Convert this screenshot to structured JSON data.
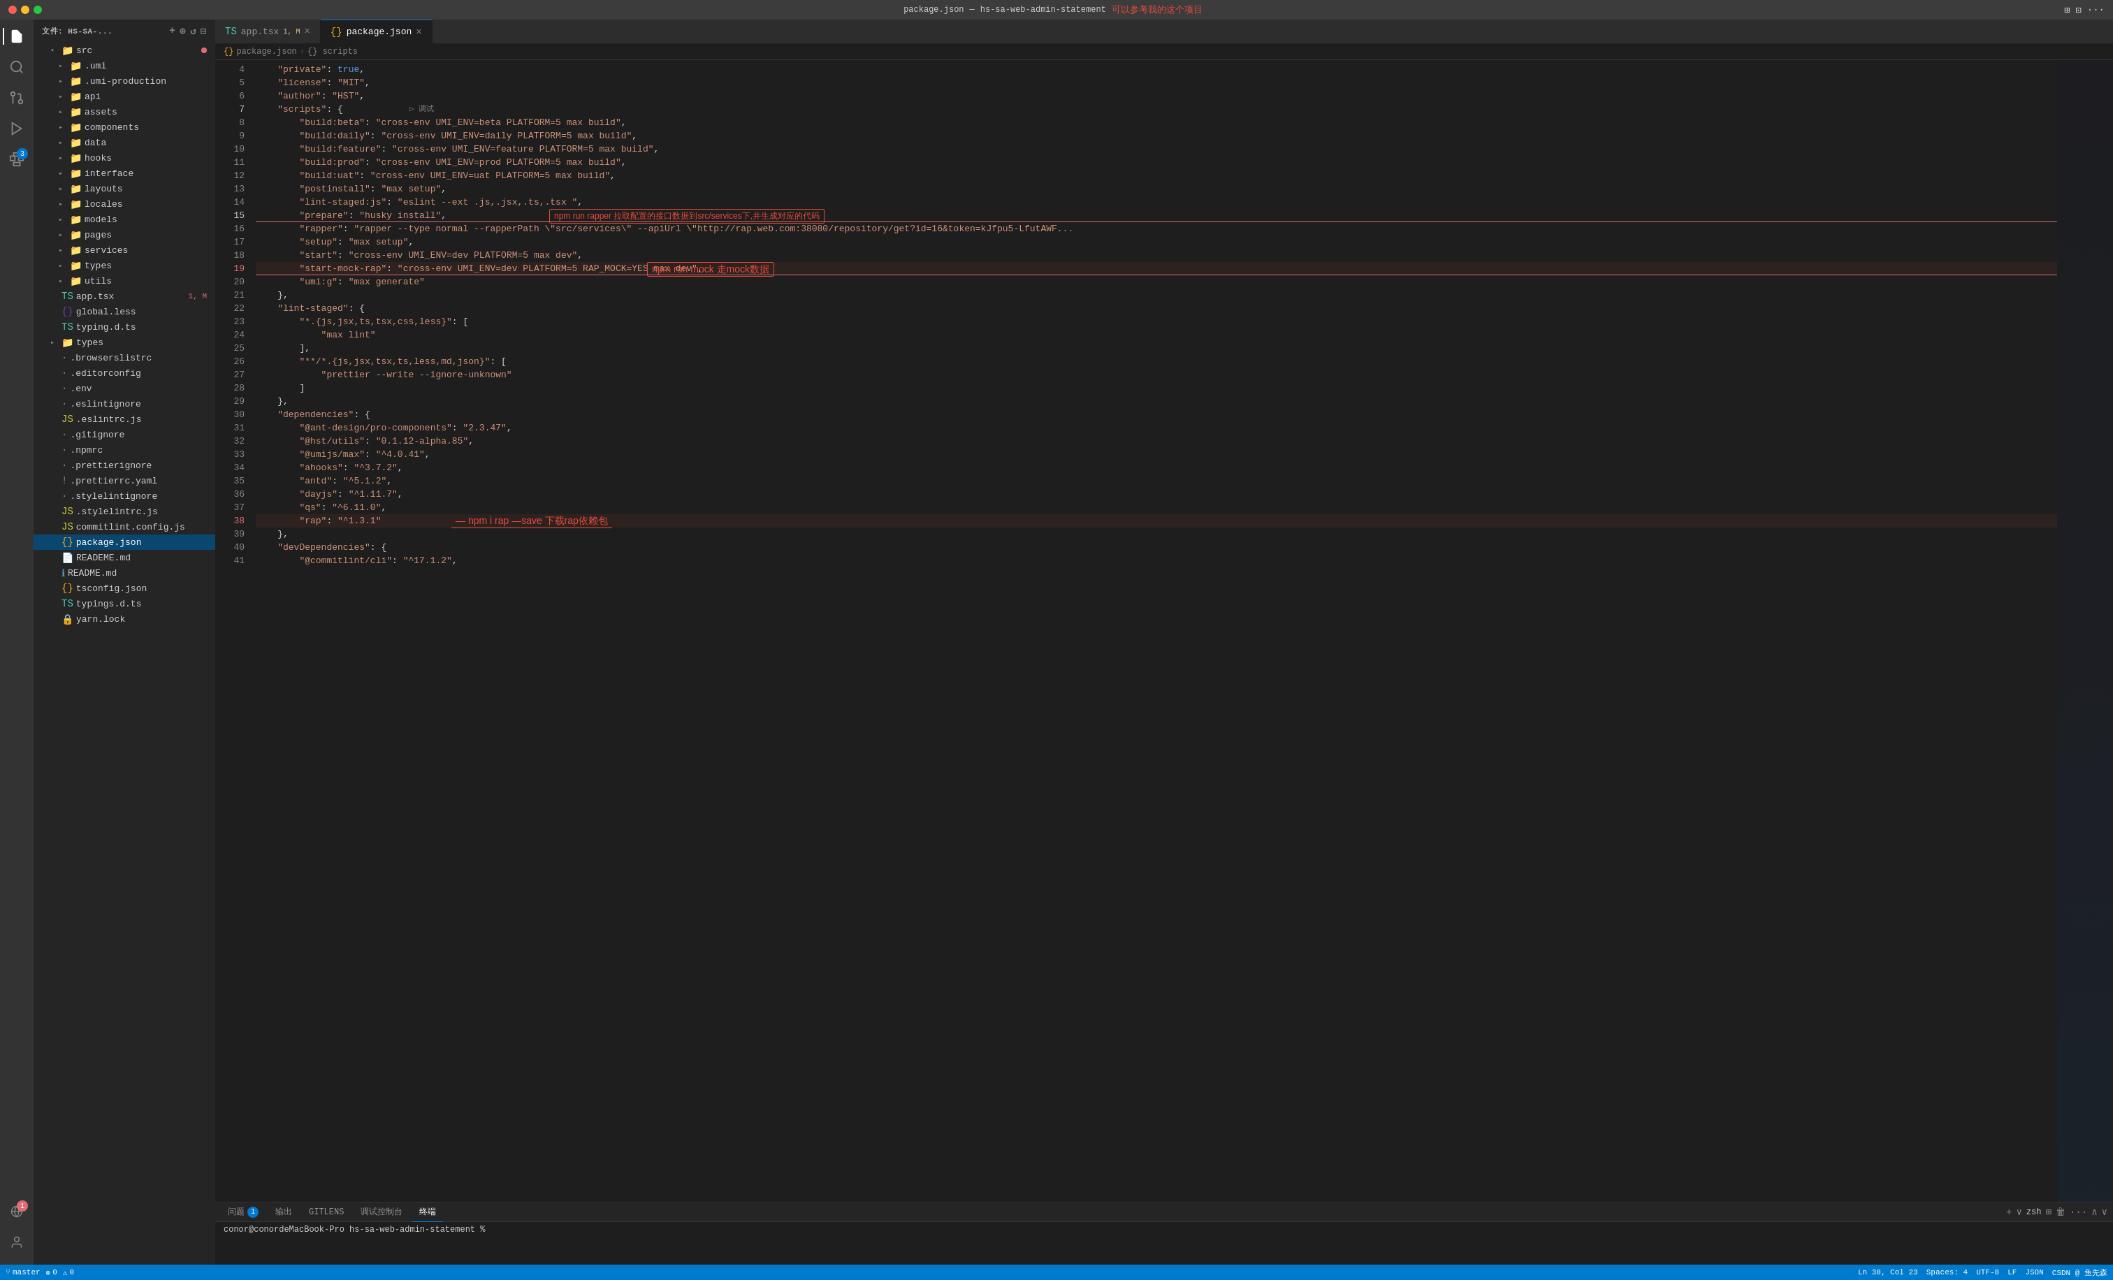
{
  "titlebar": {
    "filename": "package.json",
    "project": "hs-sa-web-admin-statement",
    "annotation": "可以参考我的这个项目"
  },
  "activitybar": {
    "icons": [
      {
        "name": "files-icon",
        "symbol": "⬛",
        "active": true
      },
      {
        "name": "search-icon",
        "symbol": "🔍",
        "active": false
      },
      {
        "name": "source-control-icon",
        "symbol": "⑂",
        "active": false
      },
      {
        "name": "run-icon",
        "symbol": "▷",
        "active": false
      },
      {
        "name": "extensions-icon",
        "symbol": "⊞",
        "active": false,
        "badge": "3"
      }
    ],
    "bottom_icons": [
      {
        "name": "remote-icon",
        "symbol": "⚡",
        "badge": "1"
      },
      {
        "name": "account-icon",
        "symbol": "👤"
      }
    ]
  },
  "sidebar": {
    "header": "文件: HS-SA-...",
    "tree": [
      {
        "level": 0,
        "label": "src",
        "type": "folder",
        "expanded": true,
        "dot": true
      },
      {
        "level": 1,
        "label": ".umi",
        "type": "folder",
        "expanded": false
      },
      {
        "level": 1,
        "label": ".umi-production",
        "type": "folder",
        "expanded": false
      },
      {
        "level": 1,
        "label": "api",
        "type": "folder",
        "expanded": false
      },
      {
        "level": 1,
        "label": "assets",
        "type": "folder",
        "expanded": false
      },
      {
        "level": 1,
        "label": "components",
        "type": "folder",
        "expanded": false
      },
      {
        "level": 1,
        "label": "data",
        "type": "folder",
        "expanded": false
      },
      {
        "level": 1,
        "label": "hooks",
        "type": "folder",
        "expanded": false
      },
      {
        "level": 1,
        "label": "interface",
        "type": "folder",
        "expanded": false
      },
      {
        "level": 1,
        "label": "layouts",
        "type": "folder",
        "expanded": false
      },
      {
        "level": 1,
        "label": "locales",
        "type": "folder",
        "expanded": false
      },
      {
        "level": 1,
        "label": "models",
        "type": "folder",
        "expanded": false
      },
      {
        "level": 1,
        "label": "pages",
        "type": "folder",
        "expanded": false
      },
      {
        "level": 1,
        "label": "services",
        "type": "folder",
        "expanded": false
      },
      {
        "level": 1,
        "label": "types",
        "type": "folder",
        "expanded": false
      },
      {
        "level": 1,
        "label": "utils",
        "type": "folder",
        "expanded": false
      },
      {
        "level": 0,
        "label": "app.tsx",
        "type": "tsx",
        "badge": "1, M"
      },
      {
        "level": 0,
        "label": "global.less",
        "type": "less"
      },
      {
        "level": 0,
        "label": "typing.d.ts",
        "type": "ts"
      },
      {
        "level": 0,
        "label": "types",
        "type": "folder"
      },
      {
        "level": 0,
        "label": ".browserslistrc",
        "type": "file"
      },
      {
        "level": 0,
        "label": ".editorconfig",
        "type": "file"
      },
      {
        "level": 0,
        "label": ".env",
        "type": "file"
      },
      {
        "level": 0,
        "label": ".eslintignore",
        "type": "file"
      },
      {
        "level": 0,
        "label": ".eslintrc.js",
        "type": "js"
      },
      {
        "level": 0,
        "label": ".gitignore",
        "type": "file"
      },
      {
        "level": 0,
        "label": ".npmrc",
        "type": "file"
      },
      {
        "level": 0,
        "label": ".prettierignore",
        "type": "file"
      },
      {
        "level": 0,
        "label": ".prettierrc.yaml",
        "type": "file"
      },
      {
        "level": 0,
        "label": ".stylelintignore",
        "type": "file"
      },
      {
        "level": 0,
        "label": ".stylelintrc.js",
        "type": "js"
      },
      {
        "level": 0,
        "label": "commitlint.config.js",
        "type": "js"
      },
      {
        "level": 0,
        "label": "package.json",
        "type": "json",
        "selected": true
      },
      {
        "level": 0,
        "label": "READEME.md",
        "type": "md"
      },
      {
        "level": 0,
        "label": "README.md",
        "type": "md"
      },
      {
        "level": 0,
        "label": "tsconfig.json",
        "type": "json"
      },
      {
        "level": 0,
        "label": "typings.d.ts",
        "type": "ts"
      },
      {
        "level": 0,
        "label": "yarn.lock",
        "type": "file"
      }
    ]
  },
  "tabs": [
    {
      "label": "app.tsx",
      "type": "tsx",
      "active": false,
      "modified": "1, M"
    },
    {
      "label": "package.json",
      "type": "json",
      "active": true,
      "modified": ""
    }
  ],
  "breadcrumb": [
    "package.json",
    "scripts"
  ],
  "lines": [
    {
      "num": 4,
      "content": "    \"private\": true,",
      "type": "normal"
    },
    {
      "num": 5,
      "content": "    \"license\": \"MIT\",",
      "type": "normal"
    },
    {
      "num": 6,
      "content": "    \"author\": \"HST\",",
      "type": "normal"
    },
    {
      "num": 7,
      "content": "    \"scripts\": {",
      "type": "normal"
    },
    {
      "num": 8,
      "content": "        \"build:beta\": \"cross-env UMI_ENV=beta PLATFORM=5 max build\",",
      "type": "normal"
    },
    {
      "num": 9,
      "content": "        \"build:daily\": \"cross-env UMI_ENV=daily PLATFORM=5 max build\",",
      "type": "normal"
    },
    {
      "num": 10,
      "content": "        \"build:feature\": \"cross-env UMI_ENV=feature PLATFORM=5 max build\",",
      "type": "normal"
    },
    {
      "num": 11,
      "content": "        \"build:prod\": \"cross-env UMI_ENV=prod PLATFORM=5 max build\",",
      "type": "normal"
    },
    {
      "num": 12,
      "content": "        \"build:uat\": \"cross-env UMI_ENV=uat PLATFORM=5 max build\",",
      "type": "normal"
    },
    {
      "num": 13,
      "content": "        \"postinstall\": \"max setup\",",
      "type": "normal"
    },
    {
      "num": 14,
      "content": "        \"lint-staged:js\": \"eslint --ext .js,.jsx,.ts,.tsx \",",
      "type": "normal"
    },
    {
      "num": 15,
      "content": "        \"prepare\": \"husky install\",",
      "type": "highlighted"
    },
    {
      "num": 16,
      "content": "        \"rapper\": \"rapper --type normal --rapperPath \\\"src/services\\\" --apiUrl \\\"http://rap.web.com:38080/repository/get?id=16&token=kJfpu5-LfutAWF...",
      "type": "normal"
    },
    {
      "num": 17,
      "content": "        \"setup\": \"max setup\",",
      "type": "normal"
    },
    {
      "num": 18,
      "content": "        \"start\": \"cross-env UMI_ENV=dev PLATFORM=5 max dev\",",
      "type": "normal"
    },
    {
      "num": 19,
      "content": "        \"start-mock-rap\": \"cross-env UMI_ENV=dev PLATFORM=5 RAP_MOCK=YES max dev\",",
      "type": "highlighted"
    },
    {
      "num": 20,
      "content": "        \"umi:g\": \"max generate\"",
      "type": "normal"
    },
    {
      "num": 21,
      "content": "    },",
      "type": "normal"
    },
    {
      "num": 22,
      "content": "    \"lint-staged\": {",
      "type": "normal"
    },
    {
      "num": 23,
      "content": "        \"*.{js,jsx,ts,tsx,css,less}\": [",
      "type": "normal"
    },
    {
      "num": 24,
      "content": "            \"max lint\"",
      "type": "normal"
    },
    {
      "num": 25,
      "content": "        ],",
      "type": "normal"
    },
    {
      "num": 26,
      "content": "        \"**/*.{js,jsx,tsx,ts,less,md,json}\": [",
      "type": "normal"
    },
    {
      "num": 27,
      "content": "            \"prettier --write --ignore-unknown\"",
      "type": "normal"
    },
    {
      "num": 28,
      "content": "        ]",
      "type": "normal"
    },
    {
      "num": 29,
      "content": "    },",
      "type": "normal"
    },
    {
      "num": 30,
      "content": "    \"dependencies\": {",
      "type": "normal"
    },
    {
      "num": 31,
      "content": "        \"@ant-design/pro-components\": \"2.3.47\",",
      "type": "normal"
    },
    {
      "num": 32,
      "content": "        \"@hst/utils\": \"0.1.12-alpha.85\",",
      "type": "normal"
    },
    {
      "num": 33,
      "content": "        \"@umijs/max\": \"^4.0.41\",",
      "type": "normal"
    },
    {
      "num": 34,
      "content": "        \"ahooks\": \"^3.7.2\",",
      "type": "normal"
    },
    {
      "num": 35,
      "content": "        \"antd\": \"^5.1.2\",",
      "type": "normal"
    },
    {
      "num": 36,
      "content": "        \"dayjs\": \"^1.11.7\",",
      "type": "normal"
    },
    {
      "num": 37,
      "content": "        \"qs\": \"^6.11.0\",",
      "type": "normal"
    },
    {
      "num": 38,
      "content": "        \"rap\": \"^1.3.1\"",
      "type": "highlighted"
    },
    {
      "num": 39,
      "content": "    },",
      "type": "normal"
    },
    {
      "num": 40,
      "content": "    \"devDependencies\": {",
      "type": "normal"
    },
    {
      "num": 41,
      "content": "        \"@commitlint/cli\": \"^17.1.2\",",
      "type": "normal"
    }
  ],
  "annotations": [
    {
      "line": 15,
      "text": "npm run rapper 拉取配置的接口数据到src/services下,并生成对应的代码",
      "color": "#e74c3c"
    },
    {
      "line": 19,
      "text": "npm run mock  走mock数据",
      "color": "#e74c3c"
    },
    {
      "line": 38,
      "text": "npm i rap —save  下载rap依赖包",
      "color": "#e74c3c"
    }
  ],
  "panel": {
    "tabs": [
      "问题",
      "输出",
      "GITLENS",
      "调试控制台",
      "终端"
    ],
    "active_tab": "终端",
    "badge": "1",
    "terminal_text": "conor@conordeMacBook-Pro hs-sa-web-admin-statement %"
  },
  "statusbar": {
    "left": [
      "⎇ master",
      "⚠ 0",
      "✗ 0"
    ],
    "right": [
      "Ln 38, Col 23",
      "Spaces: 4",
      "UTF-8",
      "LF",
      "JSON",
      "CSDN @ 鱼先森",
      "zsh"
    ]
  }
}
